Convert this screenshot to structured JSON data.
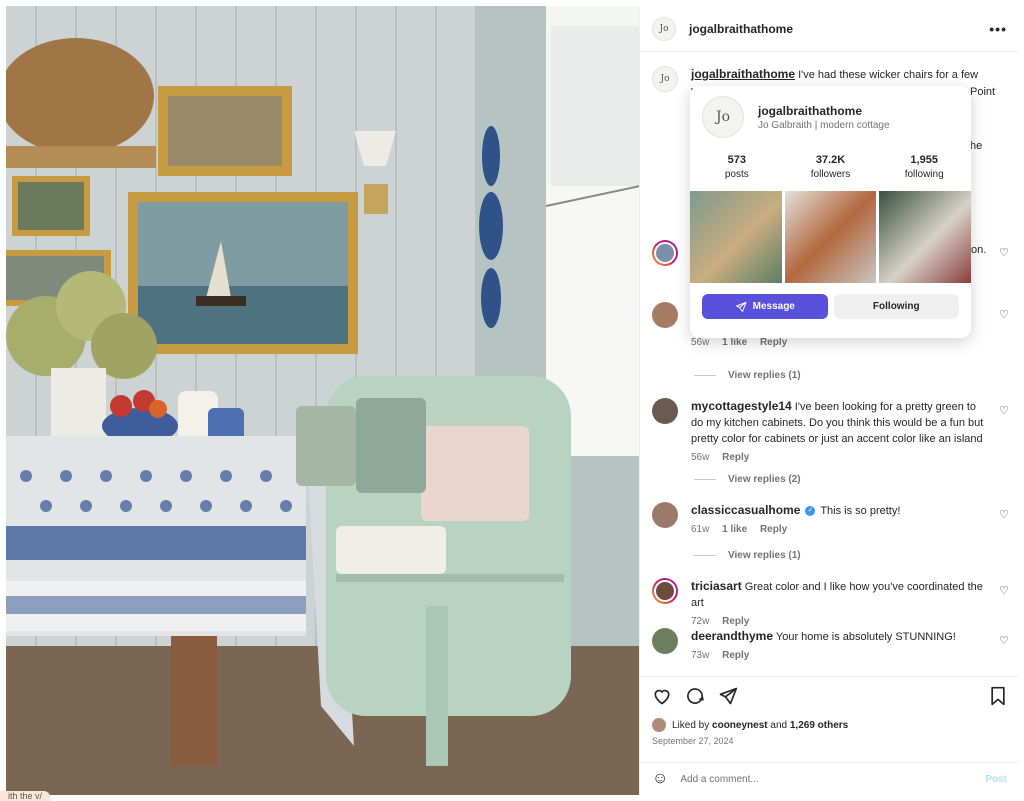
{
  "post": {
    "username": "jogalbraithathome",
    "avatar_initials": "Jo",
    "more_icon": "more-horizontal-icon"
  },
  "caption": {
    "username": "jogalbraithathome",
    "text_visible": "I've had these wicker chairs for a few years",
    "fragment_1": "Point",
    "fragment_2": "he",
    "fragment_3": "on."
  },
  "hover_card": {
    "username": "jogalbraithathome",
    "subtitle": "Jo Galbraith | modern cottage",
    "stats": [
      {
        "value": "573",
        "label": "posts"
      },
      {
        "value": "37.2K",
        "label": "followers"
      },
      {
        "value": "1,955",
        "label": "following"
      }
    ],
    "message_label": "Message",
    "following_label": "Following"
  },
  "comments": [
    {
      "username": "",
      "text": "",
      "time": "56w",
      "likes": "1 like",
      "reply": "Reply",
      "view_replies": "View replies (1)"
    },
    {
      "username": "mycottagestyle14",
      "text": "I've been looking for a pretty green to do my kitchen cabinets. Do you think this would be a fun but pretty color for cabinets or just an accent color like an island",
      "time": "56w",
      "reply": "Reply",
      "view_replies": "View replies (2)"
    },
    {
      "username": "classiccasualhome",
      "text": "This is so pretty!",
      "time": "61w",
      "likes": "1 like",
      "reply": "Reply",
      "view_replies": "View replies (1)"
    },
    {
      "username": "triciasart",
      "text": "Great color and I like how you've coordinated the art",
      "time": "72w",
      "reply": "Reply"
    },
    {
      "username": "deerandthyme",
      "text": "Your home is absolutely STUNNING!",
      "time": "73w",
      "reply": "Reply"
    }
  ],
  "footer": {
    "liked_prefix": "Liked by",
    "liked_user": "cooneynest",
    "liked_and": "and",
    "liked_others": "1,269 others",
    "date": "September 27, 2024",
    "comment_placeholder": "Add a comment...",
    "post_label": "Post"
  },
  "tooltip_text": "ith the v/",
  "colors": {
    "accent": "#5851db",
    "verified": "#3897f0",
    "muted": "#737373"
  }
}
